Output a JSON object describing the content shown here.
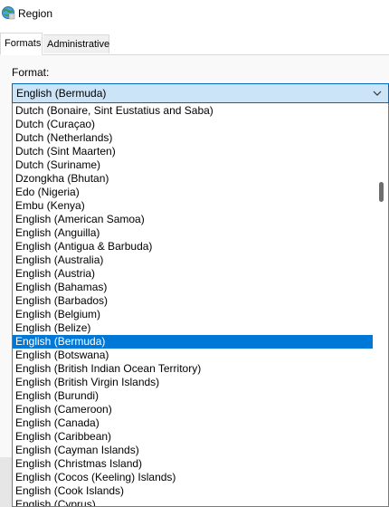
{
  "window": {
    "title": "Region",
    "icon": "region-globe-icon"
  },
  "tabs": [
    {
      "label": "Formats",
      "active": true
    },
    {
      "label": "Administrative",
      "active": false
    }
  ],
  "format": {
    "label": "Format:",
    "selected": "English (Bermuda)",
    "options_visible": [
      "Dutch (Bonaire, Sint Eustatius and Saba)",
      "Dutch (Curaçao)",
      "Dutch (Netherlands)",
      "Dutch (Sint Maarten)",
      "Dutch (Suriname)",
      "Dzongkha (Bhutan)",
      "Edo (Nigeria)",
      "Embu (Kenya)",
      "English (American Samoa)",
      "English (Anguilla)",
      "English (Antigua & Barbuda)",
      "English (Australia)",
      "English (Austria)",
      "English (Bahamas)",
      "English (Barbados)",
      "English (Belgium)",
      "English (Belize)",
      "English (Bermuda)",
      "English (Botswana)",
      "English (British Indian Ocean Territory)",
      "English (British Virgin Islands)",
      "English (Burundi)",
      "English (Cameroon)",
      "English (Canada)",
      "English (Caribbean)",
      "English (Cayman Islands)",
      "English (Christmas Island)",
      "English (Cocos (Keeling) Islands)",
      "English (Cook Islands)",
      "English (Cyprus)"
    ]
  },
  "colors": {
    "selection": "#0078d7",
    "combo_border": "#0067c0",
    "combo_fill": "#cce4f7"
  }
}
